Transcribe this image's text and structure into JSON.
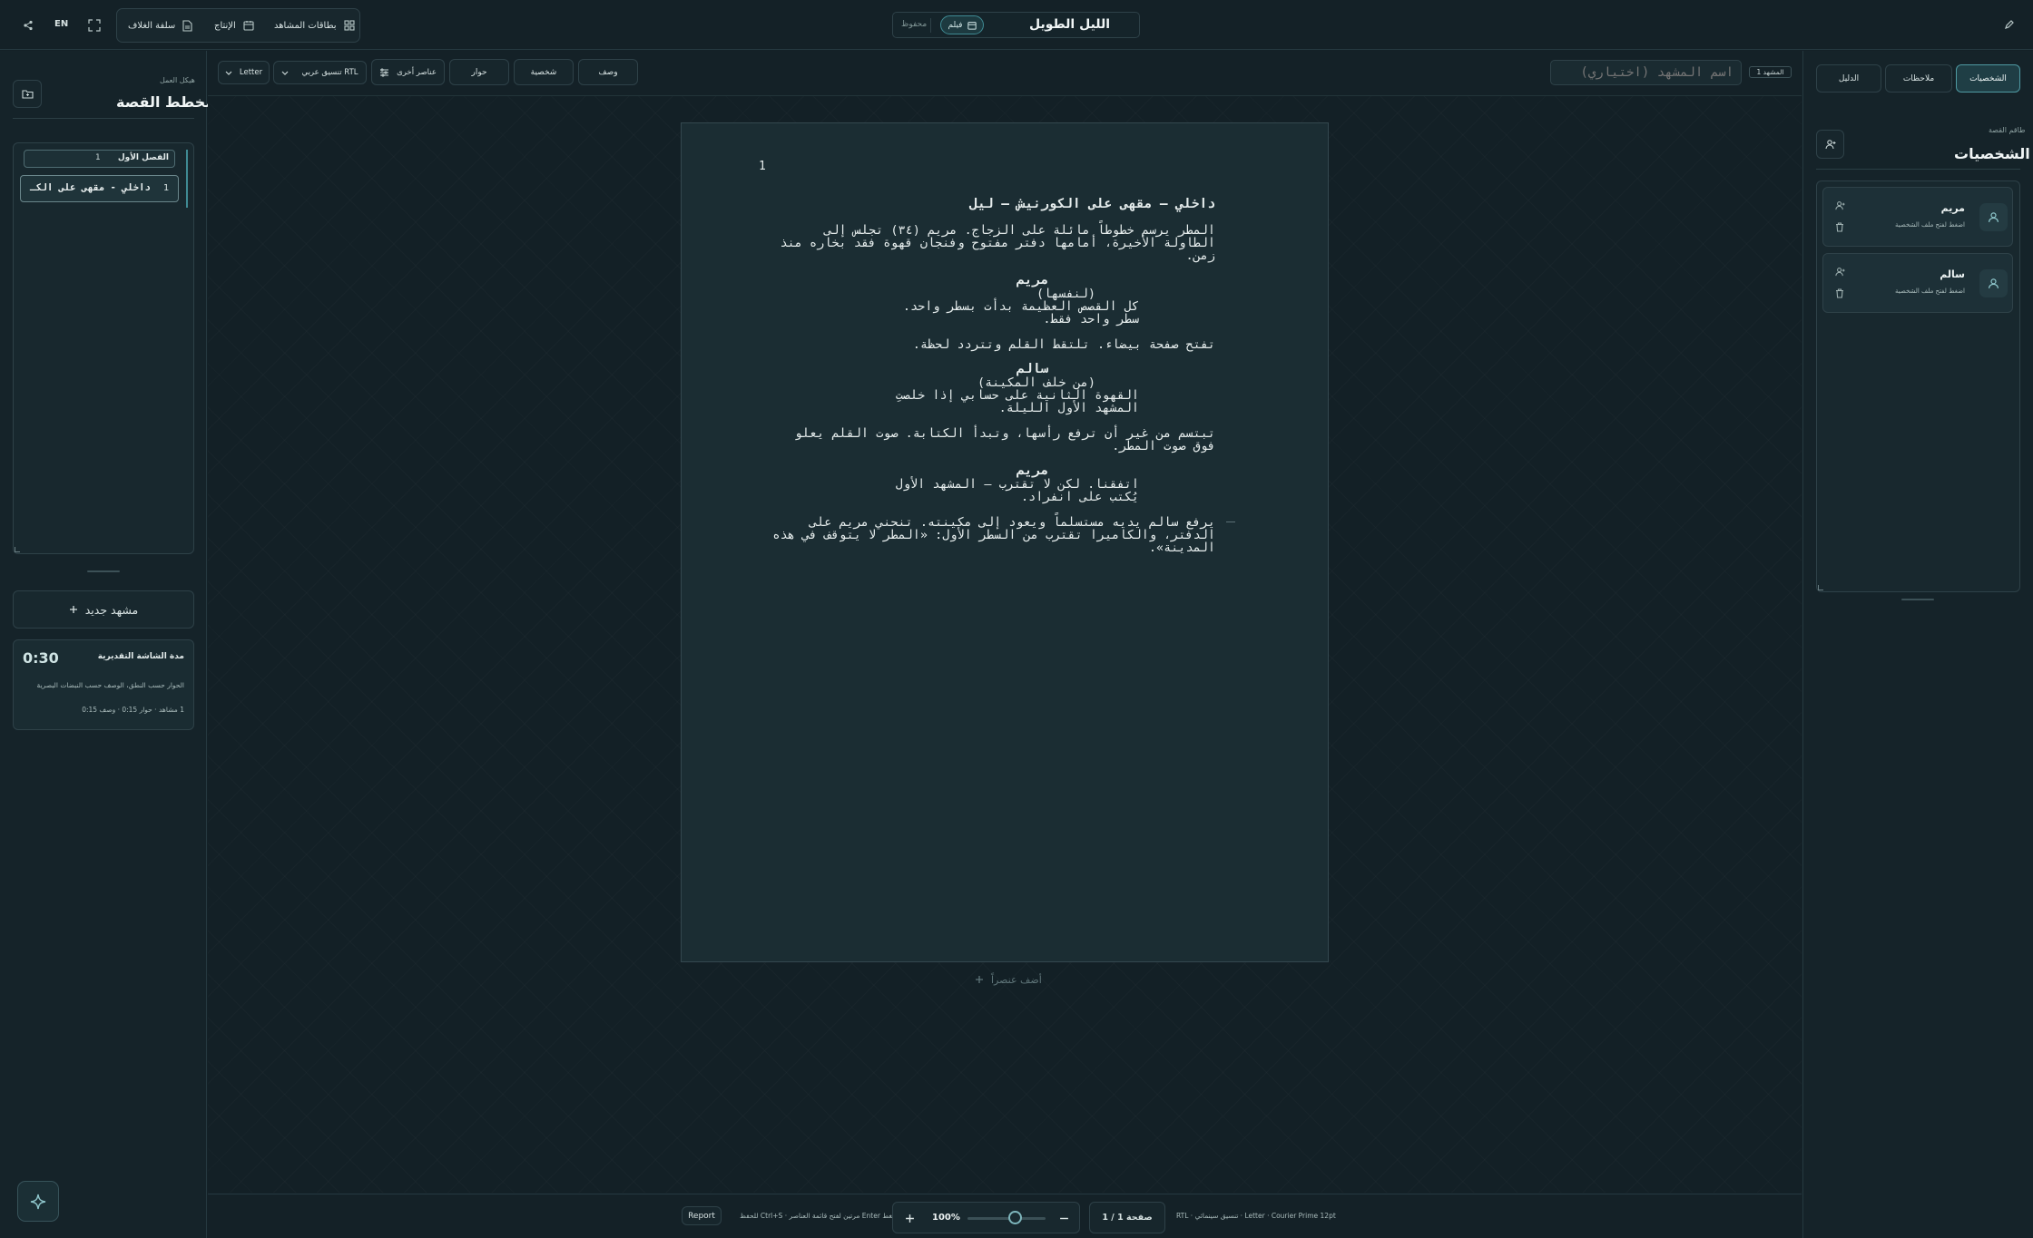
{
  "topbar": {
    "lang_label": "EN",
    "views": [
      {
        "label": "بطاقات المشاهد",
        "icon": "grid-icon"
      },
      {
        "label": "الإنتاج",
        "icon": "calendar-icon"
      },
      {
        "label": "سلفة الغلاف",
        "icon": "document-icon"
      }
    ],
    "doc_title": "الليل الطويل",
    "mode_badge": "فيلم",
    "save_status": "محفوظ"
  },
  "left_panel": {
    "subtitle": "هيكل العمل",
    "title": "مخطط القصة",
    "outline": [
      {
        "type": "act",
        "label": "الفصل الأول",
        "number": "1"
      },
      {
        "type": "scene",
        "label": "داخلي - مقهى على الكـ",
        "number": "1"
      }
    ],
    "new_scene_label": "مشهد جديد",
    "duration": {
      "title": "مدة الشاشة التقديرية",
      "value": "0:30",
      "description": "الحوار حسب النطق، الوصف حسب النبضات البصرية",
      "breakdown": "1 مشاهد · حوار 0:15 · وصف 0:15"
    }
  },
  "toolbar": {
    "element_buttons": [
      "وصف",
      "شخصية",
      "حوار"
    ],
    "more_elements_label": "عناصر أخرى",
    "format_select": "تنسيق عربي RTL",
    "paper_select": "Letter",
    "scene_name_placeholder": "اسم المشهد (اختياري)",
    "scene_label": "المشهد 1"
  },
  "page": {
    "page_number": "1",
    "heading": "داخلي – مقهى على الكورنيش – ليل",
    "action1": [
      "المطر يرسم خطوطاً مائلة على الزجاج. مريم (٣٤) تجلس إلى",
      "الطاولة الأخيرة، أمامها دفتر مفتوح وفنجان قهوة فقد بخاره منذ",
      "زمن."
    ],
    "char1": "مريم",
    "paren1": "(لنفسها)",
    "dialogue1": [
      "كل القصص العظيمة بدأت بسطر واحد.",
      "سطر واحد فقط."
    ],
    "action2": [
      "تفتح صفحة بيضاء. تلتقط القلم وتتردد لحظة."
    ],
    "char2": "سالم",
    "paren2": "(من خلف المكينة)",
    "dialogue2": [
      "القهوة الثانية على حسابي إذا خلصتِ",
      "المشهد الأول الليلة."
    ],
    "action3": [
      "تبتسم من غير أن ترفع رأسها، وتبدأ الكتابة. صوت القلم يعلو",
      "فوق صوت المطر."
    ],
    "char3": "مريم",
    "dialogue3": [
      "اتفقنا. لكن لا تقترب — المشهد الأول",
      "يُكتب على انفراد."
    ],
    "action4": [
      "يرفع سالم يديه مستسلماً ويعود إلى مكينته. تنحني مريم على",
      "الدفتر، والكاميرا تقترب من السطر الأول: «المطر لا يتوقف في هذه",
      "المدينة»."
    ],
    "add_element_label": "أضف عنصراً"
  },
  "statusbar": {
    "format_info": "RTL · تنسيق سينمائي · Letter · Courier Prime 12pt",
    "page_indicator": "صفحة 1 / 1",
    "zoom": "100%",
    "zoom_fraction": 0.6,
    "hint": "اضغط Enter مرتين لفتح قائمة العناصر · Ctrl+S للحفظ",
    "report_label": "Report"
  },
  "right_panel": {
    "tabs": [
      "الشخصيات",
      "ملاحظات",
      "الدليل"
    ],
    "subtitle": "طاقم القصة",
    "title": "الشخصيات",
    "characters": [
      {
        "name": "مريم",
        "hint": "اضغط لفتح ملف الشخصية"
      },
      {
        "name": "سالم",
        "hint": "اضغط لفتح ملف الشخصية"
      }
    ]
  }
}
